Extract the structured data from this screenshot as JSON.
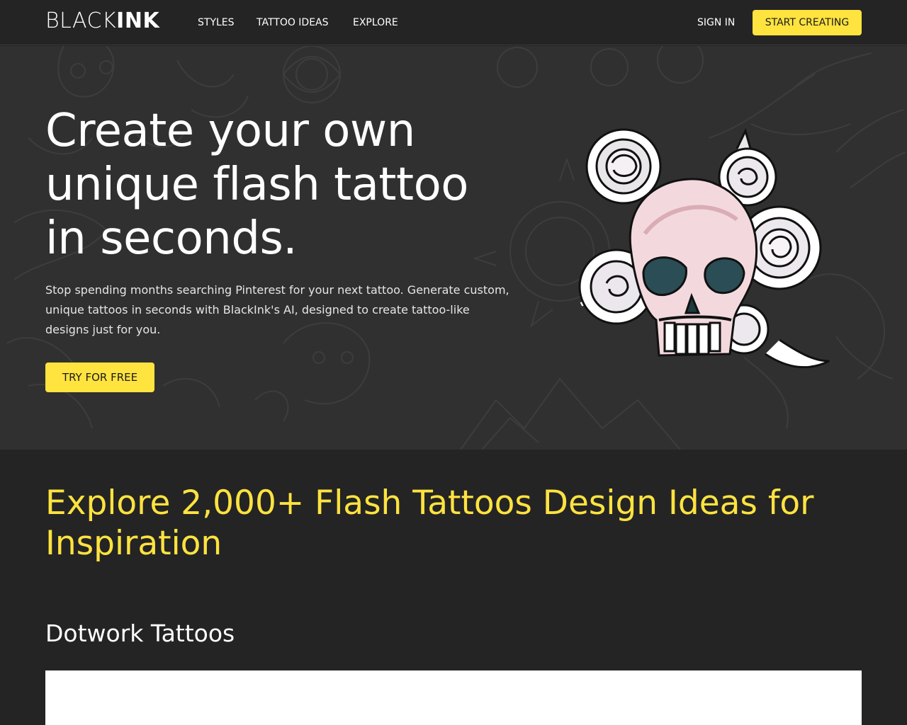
{
  "header": {
    "logo_light": "BLACK",
    "logo_bold": "INK",
    "nav": [
      "STYLES",
      "TATTOO IDEAS",
      "EXPLORE"
    ],
    "sign_in": "SIGN IN",
    "cta": "START CREATING"
  },
  "hero": {
    "title_lines": [
      "Create your own",
      "unique flash tattoo",
      "in seconds."
    ],
    "subtitle_lines": [
      "Stop spending months searching Pinterest for your next tattoo. Generate custom,",
      "unique tattoos in seconds with BlackInk's AI, designed to create tattoo-like",
      "designs just for you."
    ],
    "cta": "TRY FOR FREE"
  },
  "explore": {
    "title_lines": [
      "Explore 2,000+ Flash Tattoos Design Ideas for",
      "Inspiration"
    ],
    "section_title": "Dotwork Tattoos"
  },
  "colors": {
    "accent": "#ffe33f",
    "background": "#242424",
    "hero_background": "#303030",
    "text": "#ffffff"
  }
}
